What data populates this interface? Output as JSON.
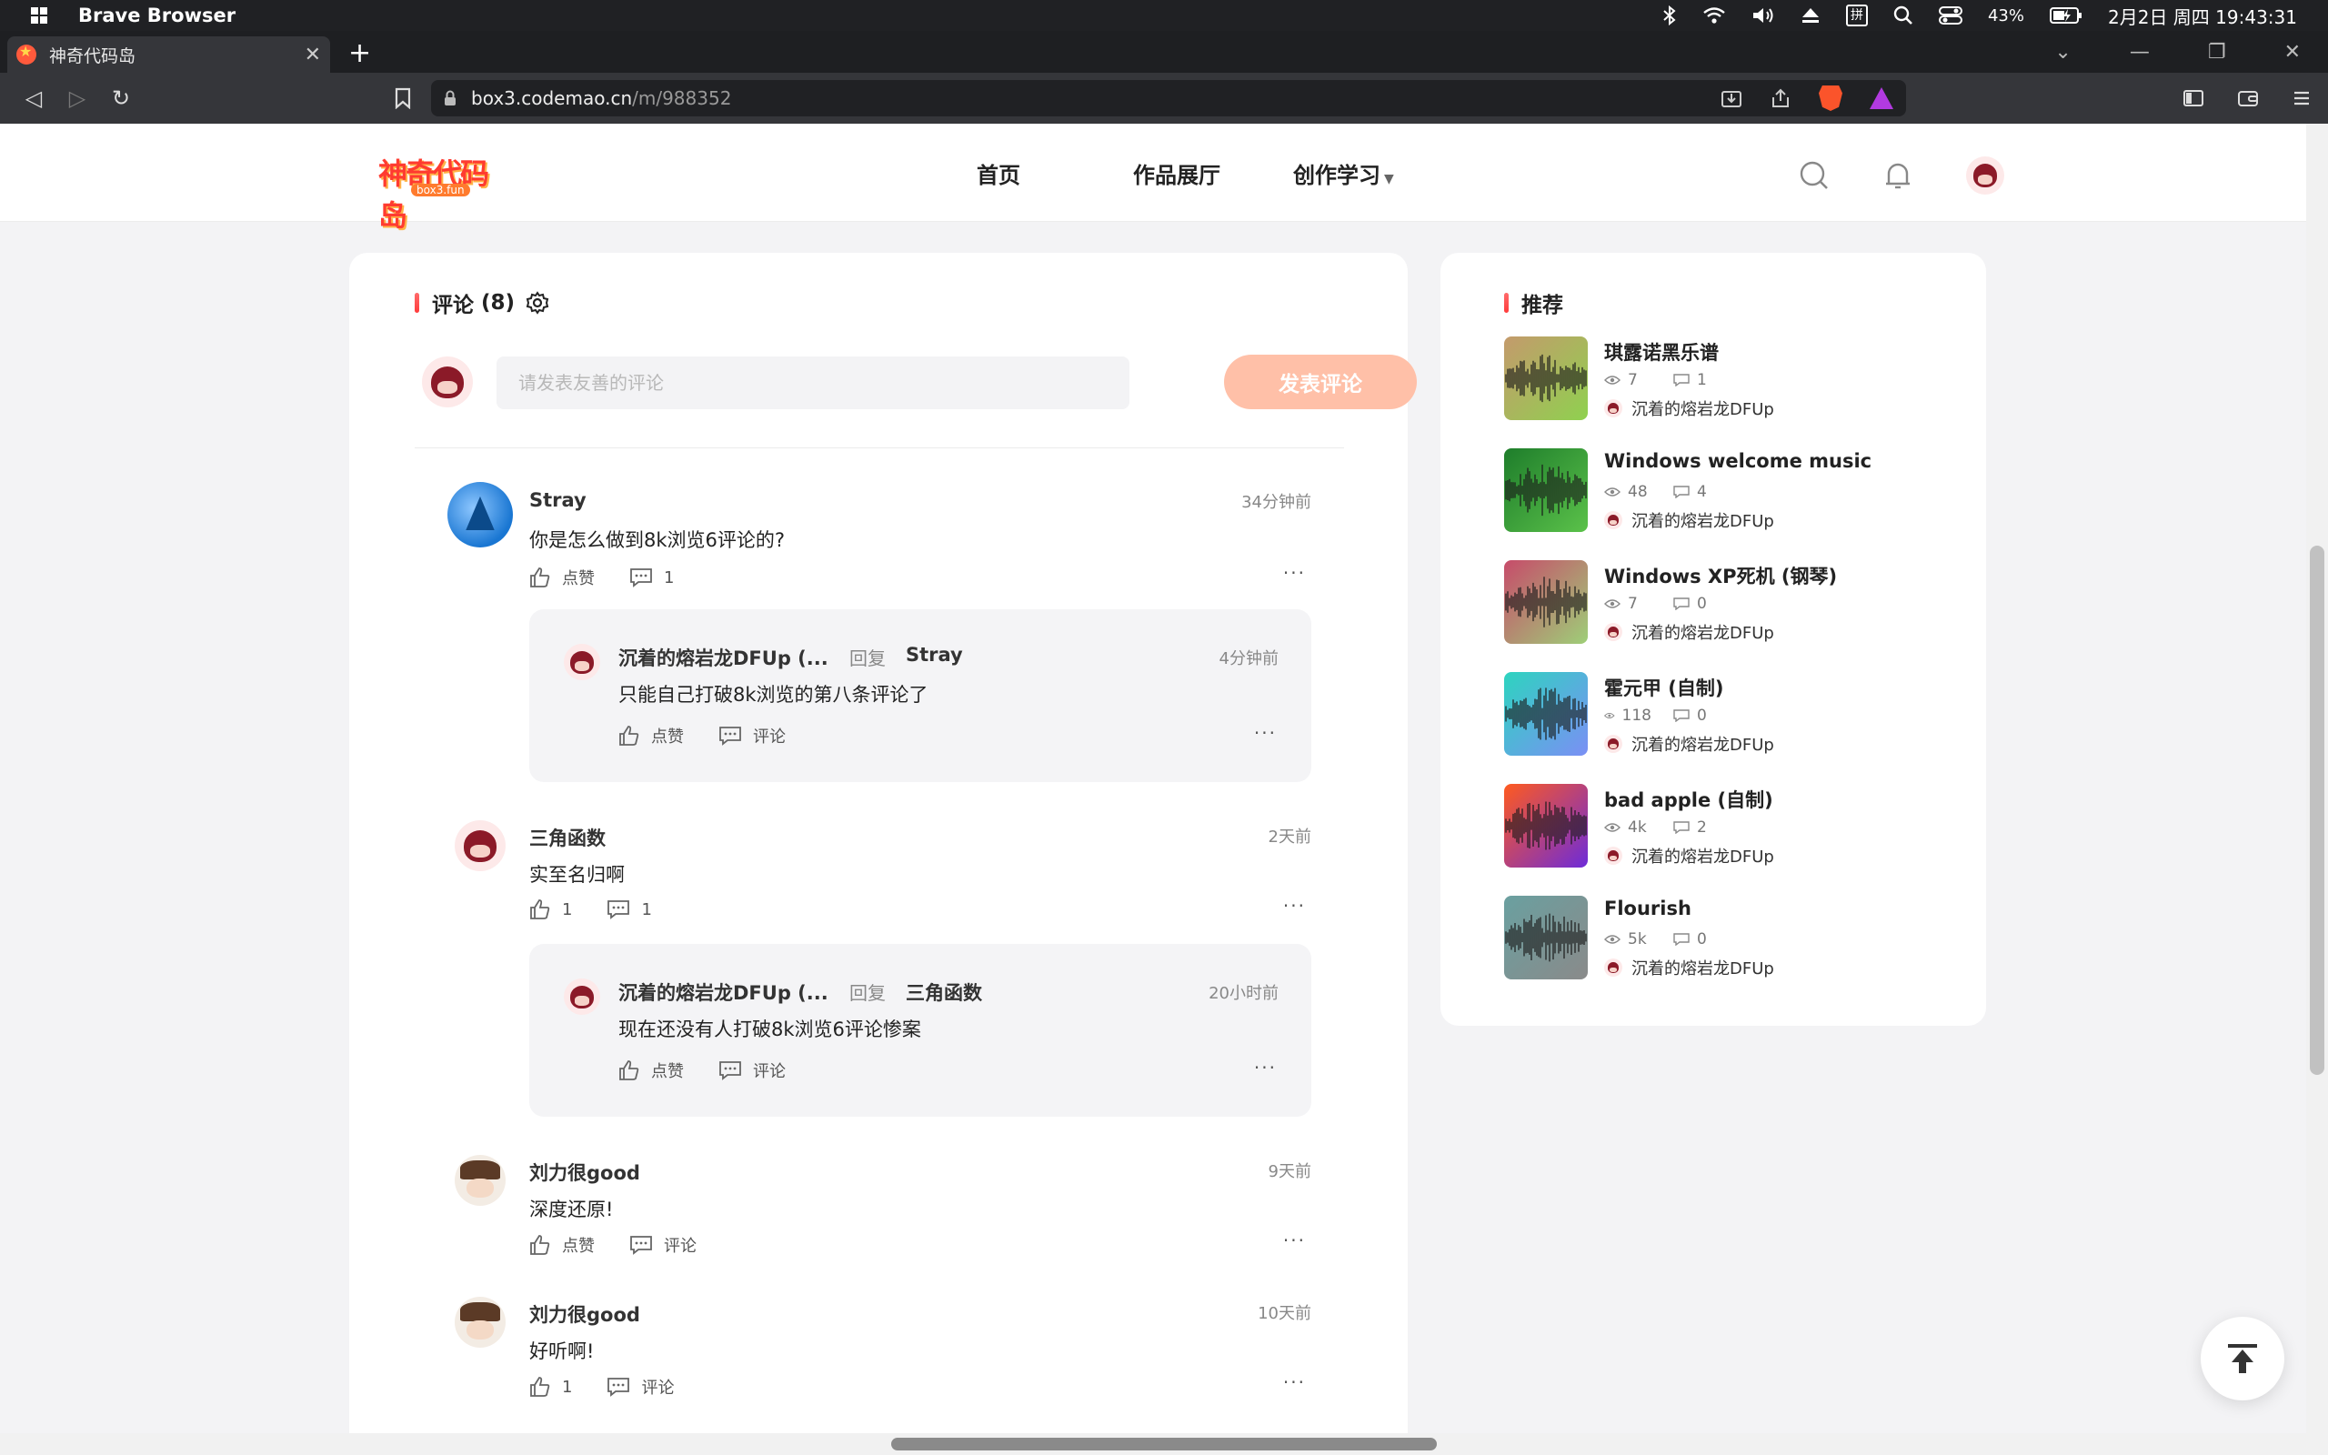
{
  "os": {
    "app_name": "Brave Browser",
    "ime": "拼",
    "battery": "43%",
    "clock": "2月2日 周四 19:43:31"
  },
  "tab": {
    "title": "神奇代码岛"
  },
  "address": {
    "host": "box3.codemao.cn",
    "path": "/m/988352"
  },
  "site": {
    "logo_text": "神奇代码岛",
    "logo_sub": "box3.fun",
    "nav": [
      "首页",
      "作品展厅",
      "创作学习"
    ]
  },
  "comments": {
    "title": "评论",
    "count": "(8)",
    "placeholder": "请发表友善的评论",
    "submit_label": "发表评论",
    "items": [
      {
        "name": "Stray",
        "time": "34分钟前",
        "text": "你是怎么做到8k浏览6评论的?",
        "like": "点赞",
        "reply": "1",
        "sub": {
          "name": "沉着的熔岩龙DFUp (...",
          "label": "回复",
          "to": "Stray",
          "time": "4分钟前",
          "text": "只能自己打破8k浏览的第八条评论了",
          "like": "点赞",
          "reply": "评论"
        }
      },
      {
        "name": "三角函数",
        "time": "2天前",
        "text": "实至名归啊",
        "like": "1",
        "reply": "1",
        "sub": {
          "name": "沉着的熔岩龙DFUp (...",
          "label": "回复",
          "to": "三角函数",
          "time": "20小时前",
          "text": "现在还没有人打破8k浏览6评论惨案",
          "like": "点赞",
          "reply": "评论"
        }
      },
      {
        "name": "刘力很good",
        "time": "9天前",
        "text": "深度还原!",
        "like": "点赞",
        "reply": "评论"
      },
      {
        "name": "刘力很good",
        "time": "10天前",
        "text": "好听啊!",
        "like": "1",
        "reply": "评论"
      }
    ]
  },
  "recommend": {
    "title": "推荐",
    "items": [
      {
        "title": "琪露诺黑乐谱",
        "views": "7",
        "comments": "1",
        "author": "沉着的熔岩龙DFUp",
        "gradient": [
          "#c49a6c",
          "#8fd14f"
        ]
      },
      {
        "title": "Windows welcome music",
        "views": "48",
        "comments": "4",
        "author": "沉着的熔岩龙DFUp",
        "gradient": [
          "#1e7d2b",
          "#5bc24a"
        ]
      },
      {
        "title": "Windows XP死机 (钢琴)",
        "views": "7",
        "comments": "0",
        "author": "沉着的熔岩龙DFUp",
        "gradient": [
          "#c74b6a",
          "#9ecf78"
        ]
      },
      {
        "title": "霍元甲 (自制)",
        "views": "118",
        "comments": "0",
        "author": "沉着的熔岩龙DFUp",
        "gradient": [
          "#2dd4bf",
          "#7b8ff5"
        ]
      },
      {
        "title": "bad apple (自制)",
        "views": "4k",
        "comments": "2",
        "author": "沉着的熔岩龙DFUp",
        "gradient": [
          "#ff5a1f",
          "#6d2bd9"
        ]
      },
      {
        "title": "Flourish",
        "views": "5k",
        "comments": "0",
        "author": "沉着的熔岩龙DFUp",
        "gradient": [
          "#6aa0a0",
          "#8a8a8a"
        ]
      }
    ]
  }
}
